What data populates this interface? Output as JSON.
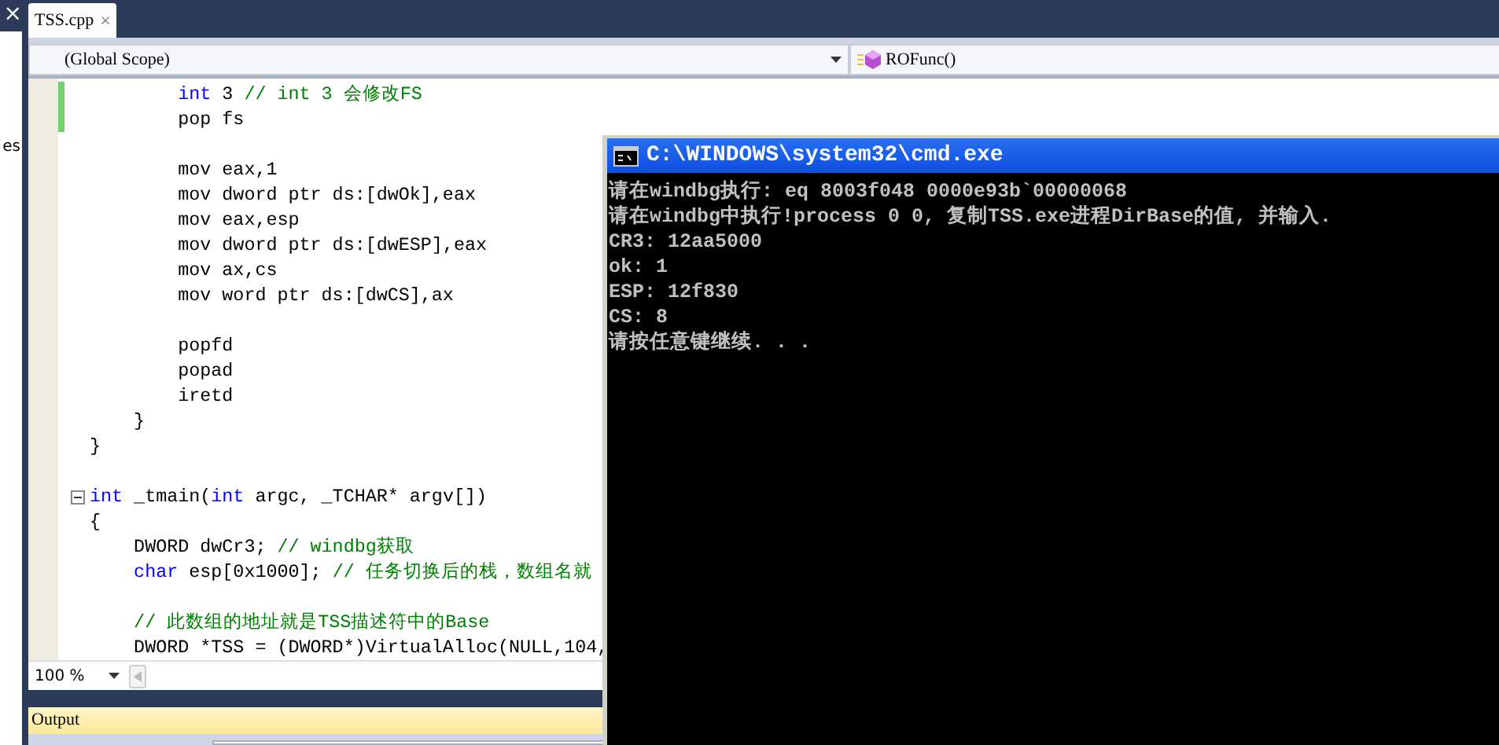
{
  "sidebar": {
    "close_glyph": "×",
    "label": "es"
  },
  "tabs": [
    {
      "label": "TSS.cpp",
      "selected": true,
      "close_glyph": "×"
    }
  ],
  "navigation": {
    "scope": "(Global Scope)",
    "member": "ROFunc()"
  },
  "code_lines": [
    {
      "changed": true,
      "tokens": [
        {
          "kind": "keyword",
          "text": "        int"
        },
        {
          "kind": "plain",
          "text": " 3 "
        },
        {
          "kind": "comment",
          "text": "// int 3 会修改FS"
        }
      ]
    },
    {
      "changed": true,
      "tokens": [
        {
          "kind": "plain",
          "text": "        pop fs"
        }
      ]
    },
    {
      "changed": false
    },
    {
      "changed": false,
      "tokens": [
        {
          "kind": "plain",
          "text": "        mov eax,1"
        }
      ]
    },
    {
      "changed": false,
      "tokens": [
        {
          "kind": "plain",
          "text": "        mov dword ptr ds:[dwOk],eax"
        }
      ]
    },
    {
      "changed": false,
      "tokens": [
        {
          "kind": "plain",
          "text": "        mov eax,esp"
        }
      ]
    },
    {
      "changed": false,
      "tokens": [
        {
          "kind": "plain",
          "text": "        mov dword ptr ds:[dwESP],eax"
        }
      ]
    },
    {
      "changed": false,
      "tokens": [
        {
          "kind": "plain",
          "text": "        mov ax,cs"
        }
      ]
    },
    {
      "changed": false,
      "tokens": [
        {
          "kind": "plain",
          "text": "        mov word ptr ds:[dwCS],ax"
        }
      ]
    },
    {
      "changed": false
    },
    {
      "changed": false,
      "tokens": [
        {
          "kind": "plain",
          "text": "        popfd"
        }
      ]
    },
    {
      "changed": false,
      "tokens": [
        {
          "kind": "plain",
          "text": "        popad"
        }
      ]
    },
    {
      "changed": false,
      "tokens": [
        {
          "kind": "plain",
          "text": "        iretd"
        }
      ]
    },
    {
      "changed": false,
      "tokens": [
        {
          "kind": "plain",
          "text": "    }"
        }
      ]
    },
    {
      "changed": false,
      "tokens": [
        {
          "kind": "plain",
          "text": "}"
        }
      ]
    },
    {
      "changed": false
    },
    {
      "changed": false,
      "fold": true,
      "tokens": [
        {
          "kind": "keyword",
          "text": "int"
        },
        {
          "kind": "plain",
          "text": " _tmain("
        },
        {
          "kind": "keyword",
          "text": "int"
        },
        {
          "kind": "plain",
          "text": " argc, _TCHAR* argv[])"
        }
      ]
    },
    {
      "changed": false,
      "tokens": [
        {
          "kind": "plain",
          "text": "{"
        }
      ]
    },
    {
      "changed": false,
      "tokens": [
        {
          "kind": "plain",
          "text": "    DWORD dwCr3; "
        },
        {
          "kind": "comment",
          "text": "// windbg获取"
        }
      ]
    },
    {
      "changed": false,
      "tokens": [
        {
          "kind": "keyword",
          "text": "    char"
        },
        {
          "kind": "plain",
          "text": " esp[0x1000]; "
        },
        {
          "kind": "comment",
          "text": "// 任务切换后的栈，数组名就"
        }
      ]
    },
    {
      "changed": false
    },
    {
      "changed": false,
      "tokens": [
        {
          "kind": "comment",
          "text": "    // 此数组的地址就是TSS描述符中的Base"
        }
      ]
    },
    {
      "changed": false,
      "tokens": [
        {
          "kind": "plain",
          "text": "    DWORD *TSS = (DWORD*)VirtualAlloc(NULL,104,"
        }
      ]
    }
  ],
  "zoom": "100 %",
  "output_panel": {
    "title": "Output"
  },
  "console": {
    "title": "C:\\WINDOWS\\system32\\cmd.exe",
    "lines": [
      "请在windbg执行: eq 8003f048 0000e93b`00000068",
      "请在windbg中执行!process 0 0, 复制TSS.exe进程DirBase的值, 并输入.",
      "CR3: 12aa5000",
      "ok: 1",
      "ESP: 12f830",
      "CS: 8",
      "请按任意键继续. . ."
    ]
  }
}
